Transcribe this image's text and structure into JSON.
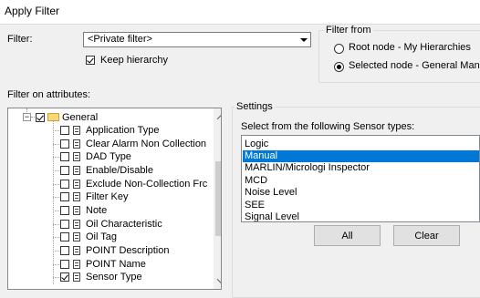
{
  "window": {
    "title": "Apply Filter"
  },
  "filter": {
    "label": "Filter:",
    "value": "<Private filter>",
    "keep_hierarchy_label": "Keep hierarchy",
    "keep_hierarchy_checked": true
  },
  "filter_from": {
    "legend": "Filter from",
    "options": [
      {
        "label": "Root node - My Hierarchies",
        "selected": false
      },
      {
        "label": "Selected node - General Manu",
        "selected": true
      }
    ]
  },
  "attributes": {
    "label": "Filter on attributes:",
    "group": {
      "label": "General",
      "checked": true
    },
    "items": [
      {
        "label": "Application Type",
        "checked": false
      },
      {
        "label": "Clear Alarm Non Collection",
        "checked": false
      },
      {
        "label": "DAD Type",
        "checked": false
      },
      {
        "label": "Enable/Disable",
        "checked": false
      },
      {
        "label": "Exclude Non-Collection Frc",
        "checked": false
      },
      {
        "label": "Filter Key",
        "checked": false
      },
      {
        "label": "Note",
        "checked": false
      },
      {
        "label": "Oil Characteristic",
        "checked": false
      },
      {
        "label": "Oil Tag",
        "checked": false
      },
      {
        "label": "POINT Description",
        "checked": false
      },
      {
        "label": "POINT Name",
        "checked": false
      },
      {
        "label": "Sensor Type",
        "checked": true
      }
    ]
  },
  "settings": {
    "legend": "Settings",
    "prompt": "Select from the following Sensor types:",
    "sensor_types": [
      "Logic",
      "Manual",
      "MARLIN/Micrologi Inspector",
      "MCD",
      "Noise Level",
      "SEE",
      "Signal Level"
    ],
    "selected": "Manual",
    "all_button": "All",
    "clear_button": "Clear"
  },
  "colors": {
    "selection": "#0078d7",
    "folder": "#f8d775"
  }
}
